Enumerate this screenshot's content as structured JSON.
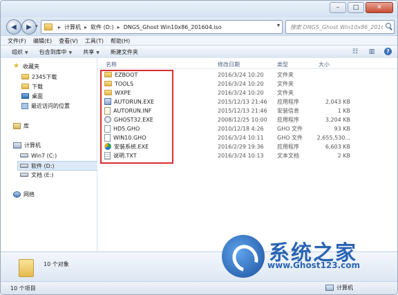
{
  "window": {
    "minimize_glyph": "–",
    "maximize_glyph": "□",
    "close_glyph": "✕"
  },
  "nav": {
    "back_glyph": "◀",
    "forward_glyph": "▶",
    "dropdown_glyph": "▾",
    "address": [
      "计算机",
      "软件 (D:)",
      "DNGS_Ghost Win10x86_201604.iso"
    ],
    "address_sep": "▸",
    "address_tail": "▾",
    "refresh_glyph": "↻",
    "search_placeholder": "搜索 DNGS_Ghost Win10x86_2016..."
  },
  "menu": [
    "文件(F)",
    "编辑(E)",
    "查看(V)",
    "工具(T)",
    "帮助(H)"
  ],
  "toolbar": {
    "items": [
      "组织",
      "包含到库中",
      "共享",
      "新建文件夹"
    ],
    "dropdown_glyph": "▼",
    "view_glyph": "☷",
    "pane_glyph": "▥",
    "help_glyph": "?"
  },
  "sidebar": {
    "favorites": "收藏夹",
    "fav_items": [
      "2345下载",
      "下载",
      "桌面",
      "最近访问的位置"
    ],
    "libraries": "库",
    "computer": "计算机",
    "drives": [
      "Win7 (C:)",
      "软件 (D:)",
      "文档 (E:)"
    ],
    "network": "网络"
  },
  "columns": {
    "name": "名称",
    "date": "修改日期",
    "type": "类型",
    "size": "大小"
  },
  "files": [
    {
      "name": "EZBOOT",
      "date": "2016/3/24 10:20",
      "type": "文件夹",
      "size": "",
      "icon": "folder"
    },
    {
      "name": "TOOLS",
      "date": "2016/3/24 10:20",
      "type": "文件夹",
      "size": "",
      "icon": "folder"
    },
    {
      "name": "WXPE",
      "date": "2016/3/24 10:20",
      "type": "文件夹",
      "size": "",
      "icon": "folder"
    },
    {
      "name": "AUTORUN.EXE",
      "date": "2015/12/13 21:46",
      "type": "应用程序",
      "size": "2,043 KB",
      "icon": "exe"
    },
    {
      "name": "AUTORUN.INF",
      "date": "2015/12/13 21:46",
      "type": "安装信息",
      "size": "1 KB",
      "icon": "inf"
    },
    {
      "name": "GHOST32.EXE",
      "date": "2008/12/25 10:00",
      "type": "应用程序",
      "size": "3,204 KB",
      "icon": "ghost"
    },
    {
      "name": "HD5.GHO",
      "date": "2010/12/18 4:26",
      "type": "GHO 文件",
      "size": "93 KB",
      "icon": "file"
    },
    {
      "name": "WIN10.GHO",
      "date": "2016/3/24 10:11",
      "type": "GHO 文件",
      "size": "2,655,530...",
      "icon": "file"
    },
    {
      "name": "安装系统.EXE",
      "date": "2016/2/29 19:36",
      "type": "应用程序",
      "size": "6,603 KB",
      "icon": "setup"
    },
    {
      "name": "说明.TXT",
      "date": "2016/3/24 10:13",
      "type": "文本文档",
      "size": "2 KB",
      "icon": "txt"
    }
  ],
  "details": {
    "count": "10 个对象"
  },
  "status": {
    "count": "10 个项目",
    "location": "计算机"
  },
  "watermark": {
    "title": "系统之家",
    "url": "www.Ghost123.com"
  },
  "colors": {
    "highlight_box": "#d92e2e",
    "logo_blue": "#2a64b4"
  }
}
